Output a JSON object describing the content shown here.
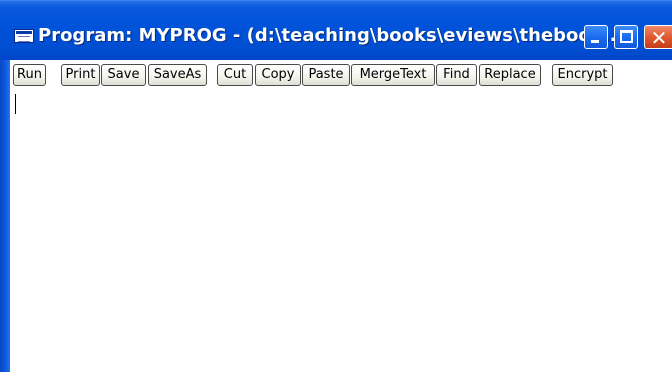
{
  "window": {
    "title": "Program: MYPROG - (d:\\teaching\\books\\eviews\\thebook..."
  },
  "toolbar": {
    "buttons": [
      {
        "label": "Run"
      },
      {
        "label": "Print"
      },
      {
        "label": "Save"
      },
      {
        "label": "SaveAs"
      },
      {
        "label": "Cut"
      },
      {
        "label": "Copy"
      },
      {
        "label": "Paste"
      },
      {
        "label": "MergeText"
      },
      {
        "label": "Find"
      },
      {
        "label": "Replace"
      },
      {
        "label": "Encrypt"
      }
    ]
  },
  "editor": {
    "content": ""
  },
  "icons": {
    "app": "program-window-icon",
    "minimize": "minimize-icon",
    "maximize": "maximize-icon",
    "close": "close-icon"
  },
  "colors": {
    "titlebar": "#0052d8",
    "close_button": "#e05a32",
    "background": "#ffffff"
  }
}
